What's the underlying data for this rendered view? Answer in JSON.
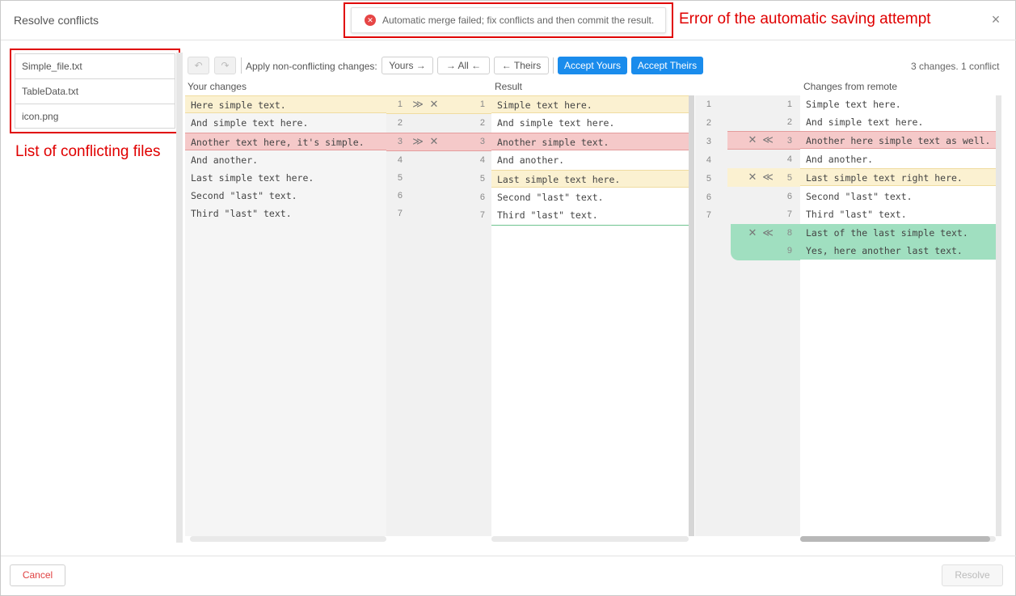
{
  "dialog": {
    "title": "Resolve conflicts",
    "close_glyph": "×"
  },
  "error": {
    "icon": "error-circle-icon",
    "icon_glyph": "✕",
    "message": "Automatic merge failed; fix conflicts and then commit the result."
  },
  "annotations": {
    "error_caption": "Error of the automatic saving attempt",
    "files_caption": "List of conflicting files"
  },
  "files": [
    {
      "name": "Simple_file.txt"
    },
    {
      "name": "TableData.txt"
    },
    {
      "name": "icon.png"
    }
  ],
  "toolbar": {
    "undo_glyph": "↶",
    "redo_glyph": "↷",
    "apply_label": "Apply non-conflicting changes:",
    "yours_label": "Yours →",
    "all_label": "→ All ←",
    "theirs_label": "← Theirs",
    "accept_yours": "Accept Yours",
    "accept_theirs": "Accept Theirs",
    "summary": "3 changes. 1 conflict"
  },
  "columns": {
    "yours": "Your changes",
    "result": "Result",
    "remote": "Changes from remote"
  },
  "yours_lines": [
    {
      "text": "Here simple text.",
      "ln": "1"
    },
    {
      "text": "And simple text here.",
      "ln": "2"
    },
    {
      "text": "Another text here, it's simple.",
      "ln": "3"
    },
    {
      "text": "And another.",
      "ln": "4"
    },
    {
      "text": "Last simple text here.",
      "ln": "5"
    },
    {
      "text": "Second \"last\" text.",
      "ln": "6"
    },
    {
      "text": "Third \"last\" text.",
      "ln": "7"
    }
  ],
  "result_lines": [
    {
      "text": "Simple text here.",
      "ln": "1"
    },
    {
      "text": "And simple text here.",
      "ln": "2"
    },
    {
      "text": "Another simple text.",
      "ln": "3"
    },
    {
      "text": "And another.",
      "ln": "4"
    },
    {
      "text": "Last simple text here.",
      "ln": "5"
    },
    {
      "text": "Second \"last\" text.",
      "ln": "6"
    },
    {
      "text": "Third \"last\" text.",
      "ln": "7"
    }
  ],
  "remote_left_ln": [
    "1",
    "2",
    "3",
    "4",
    "5",
    "6",
    "7"
  ],
  "remote_lines": [
    {
      "text": "Simple text here.",
      "ln": "1"
    },
    {
      "text": "And simple text here.",
      "ln": "2"
    },
    {
      "text": "Another here simple text as well.",
      "ln": "3"
    },
    {
      "text": "And another.",
      "ln": "4"
    },
    {
      "text": "Last simple text right here.",
      "ln": "5"
    },
    {
      "text": "Second \"last\" text.",
      "ln": "6"
    },
    {
      "text": "Third \"last\" text.",
      "ln": "7"
    },
    {
      "text": "Last of the last simple text.",
      "ln": "8"
    },
    {
      "text": "Yes, here another last text.",
      "ln": "9"
    }
  ],
  "action_glyphs": {
    "apply_right": "≫",
    "discard": "✕",
    "apply_left": "≪"
  },
  "footer": {
    "cancel": "Cancel",
    "resolve": "Resolve"
  },
  "colors": {
    "primary": "#1a8cec",
    "conflict": "#f5c9c9",
    "change": "#fbf1d1",
    "added": "#a0dfc0",
    "annotation": "#e00000"
  }
}
